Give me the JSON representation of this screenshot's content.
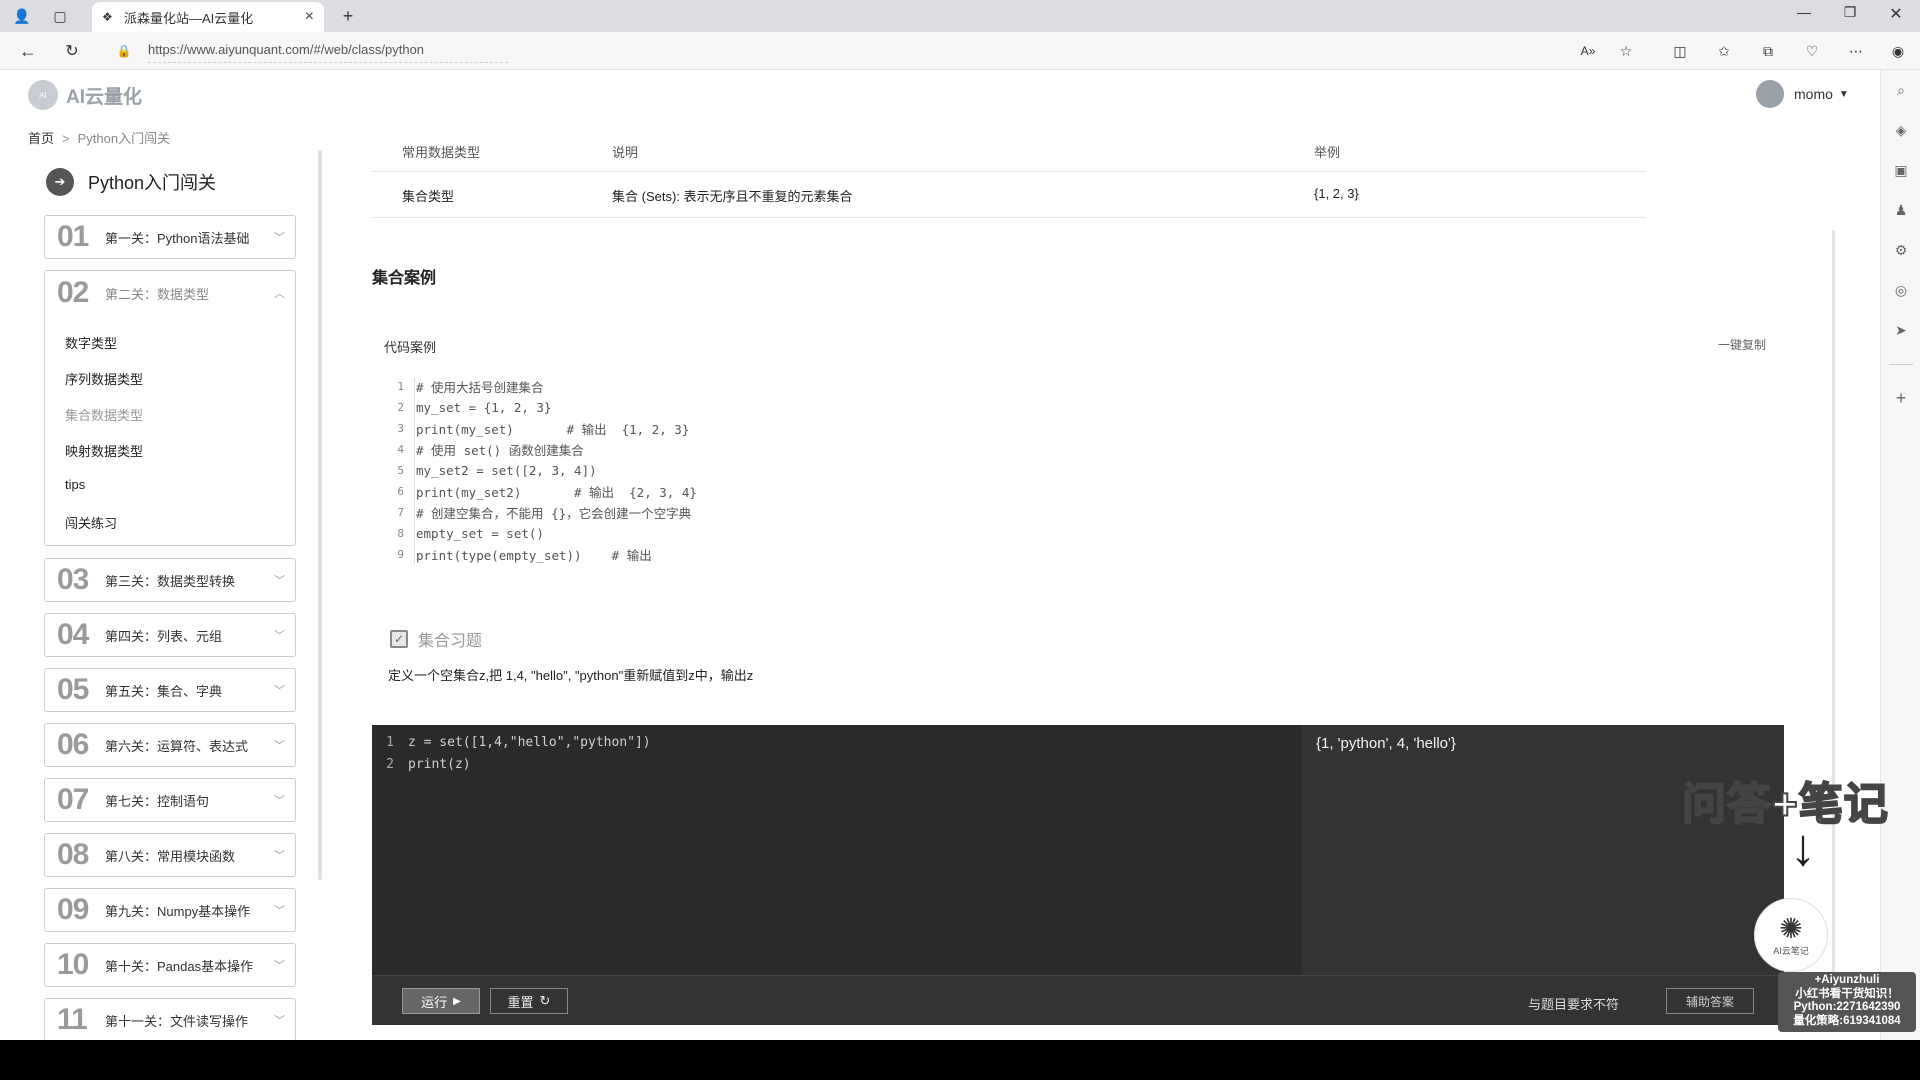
{
  "browser": {
    "tab_title": "派森量化站—AI云量化",
    "url": "https://www.aiyunquant.com/#/web/class/python"
  },
  "header": {
    "logo_text": "AI云量化",
    "user_name": "momo"
  },
  "breadcrumb": {
    "home": "首页",
    "current": "Python入门闯关"
  },
  "sidebar": {
    "title": "Python入门闯关",
    "levels": [
      {
        "num": "01",
        "label": "第一关：Python语法基础"
      },
      {
        "num": "02",
        "label": "第二关：数据类型"
      },
      {
        "num": "03",
        "label": "第三关：数据类型转换"
      },
      {
        "num": "04",
        "label": "第四关：列表、元组"
      },
      {
        "num": "05",
        "label": "第五关：集合、字典"
      },
      {
        "num": "06",
        "label": "第六关：运算符、表达式"
      },
      {
        "num": "07",
        "label": "第七关：控制语句"
      },
      {
        "num": "08",
        "label": "第八关：常用模块函数"
      },
      {
        "num": "09",
        "label": "第九关：Numpy基本操作"
      },
      {
        "num": "10",
        "label": "第十关：Pandas基本操作"
      },
      {
        "num": "11",
        "label": "第十一关：文件读写操作"
      }
    ],
    "sub_items": [
      "数字类型",
      "序列数据类型",
      "集合数据类型",
      "映射数据类型",
      "tips",
      "闯关练习"
    ]
  },
  "table": {
    "headers": [
      "常用数据类型",
      "说明",
      "举例"
    ],
    "row": [
      "集合类型",
      "集合 (Sets): 表示无序且不重复的元素集合",
      "{1, 2, 3}"
    ]
  },
  "section": {
    "title": "集合案例",
    "code_label": "代码案例",
    "copy_label": "一键复制"
  },
  "code_lines": [
    "# 使用大括号创建集合",
    "my_set = {1, 2, 3}",
    "print(my_set)       # 输出  {1, 2, 3}",
    "# 使用 set() 函数创建集合",
    "my_set2 = set([2, 3, 4])",
    "print(my_set2)       # 输出  {2, 3, 4}",
    "# 创建空集合，不能用 {}，它会创建一个空字典",
    "empty_set = set()",
    "print(type(empty_set))    # 输出"
  ],
  "exercise": {
    "title": "集合习题",
    "description": "定义一个空集合z,把 1,4, \"hello\", \"python\"重新赋值到z中，输出z"
  },
  "editor": {
    "lines": [
      "z = set([1,4,\"hello\",\"python\"])",
      "print(z)"
    ],
    "output": "{1, 'python', 4, 'hello'}",
    "run_label": "运行",
    "reset_label": "重置",
    "status": "与题目要求不符",
    "hint_label": "辅助答案"
  },
  "overlay": {
    "note": "问答+笔记",
    "badge_label": "AI云笔记",
    "promo_lines": [
      "+Aiyunzhuli",
      "小红书看干货知识！",
      "Python:2271642390",
      "量化策略:619341084"
    ]
  }
}
